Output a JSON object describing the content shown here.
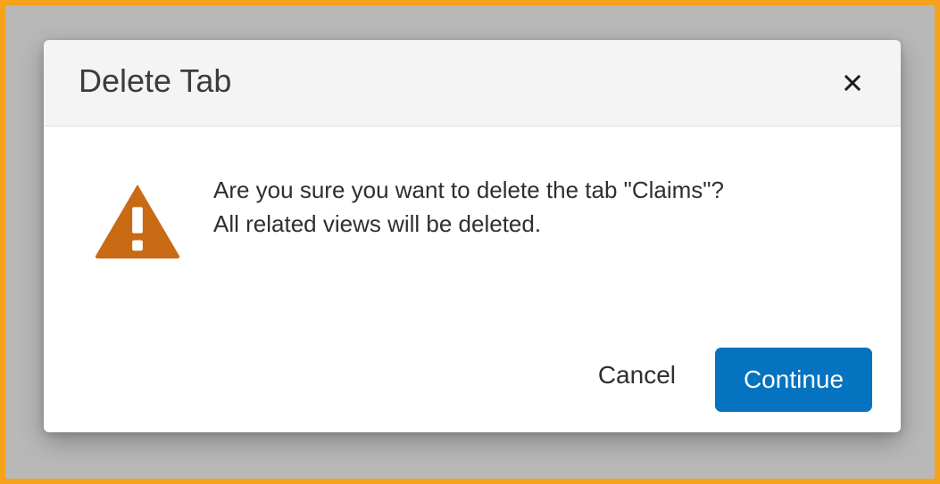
{
  "dialog": {
    "title": "Delete Tab",
    "close_icon": "close-icon",
    "warning_icon": "warning-icon",
    "message_line_1": "Are you sure you want to delete the tab \"Claims\"?",
    "message_line_2": "All related views will be deleted.",
    "cancel_label": "Cancel",
    "continue_label": "Continue"
  },
  "colors": {
    "page_border": "#f7a21b",
    "backdrop": "#bcbcbc",
    "header_bg": "#f4f4f4",
    "warning": "#c96a14",
    "primary_button": "#0573bf"
  }
}
